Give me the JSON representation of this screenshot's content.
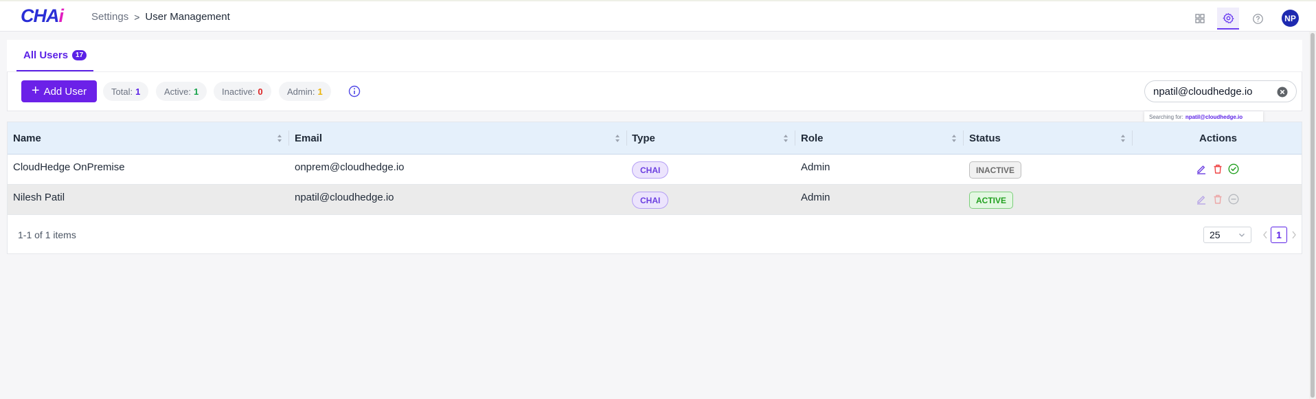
{
  "app": {
    "logo_part1": "CHA",
    "logo_part2": "i"
  },
  "breadcrumb": {
    "parent": "Settings",
    "separator": ">",
    "current": "User Management"
  },
  "header_icons": [
    "grid-icon",
    "gear-icon",
    "help-icon"
  ],
  "user": {
    "initials": "NP"
  },
  "tabs": [
    {
      "label": "All Users",
      "count": "17"
    }
  ],
  "toolbar": {
    "add_label": "Add User",
    "stats": {
      "total_label": "Total:",
      "total_value": "1",
      "active_label": "Active:",
      "active_value": "1",
      "inactive_label": "Inactive:",
      "inactive_value": "0",
      "admin_label": "Admin:",
      "admin_value": "1"
    }
  },
  "search": {
    "value": "npatil@cloudhedge.io",
    "hint_prefix": "Searching for:",
    "hint_query": "npatil@cloudhedge.io"
  },
  "table": {
    "columns": [
      "Name",
      "Email",
      "Type",
      "Role",
      "Status",
      "Actions"
    ],
    "rows": [
      {
        "name": "CloudHedge OnPremise",
        "email": "onprem@cloudhedge.io",
        "type": "CHAI",
        "role": "Admin",
        "status": "INACTIVE"
      },
      {
        "name": "Nilesh Patil",
        "email": "npatil@cloudhedge.io",
        "type": "CHAI",
        "role": "Admin",
        "status": "ACTIVE"
      }
    ]
  },
  "pagination": {
    "items_text": "1-1 of 1 items",
    "page_size": "25",
    "current_page": "1"
  },
  "colors": {
    "accent": "#5b21e6",
    "primary_button": "#6b21e8",
    "active_green": "#22a020",
    "inactive_red": "#dc2626",
    "admin_yellow": "#eab308",
    "table_header": "#e5f0fb"
  }
}
